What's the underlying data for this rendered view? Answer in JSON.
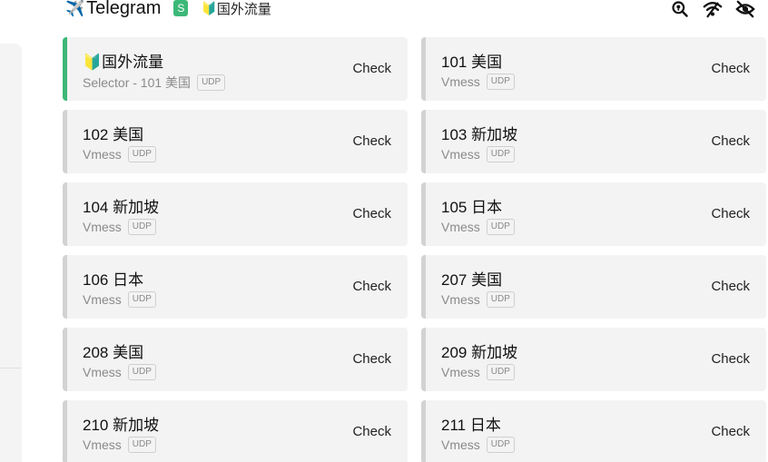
{
  "header": {
    "group_icon": "✈️",
    "group_name": "Telegram",
    "type_badge": "S",
    "now_icon": "🔰",
    "now_name": "国外流量"
  },
  "actions": [
    {
      "icon": "location-search-icon"
    },
    {
      "icon": "wifi-check-icon"
    },
    {
      "icon": "eye-off-icon"
    }
  ],
  "colors": {
    "accent": "#3cb878",
    "card_bg": "#f3f3f3",
    "inactive_bar": "#d2d2d2"
  },
  "proxies": [
    {
      "name": "🔰国外流量",
      "type": "Selector - 101 美国",
      "udp": "UDP",
      "action": "Check",
      "selected": true
    },
    {
      "name": "101 美国",
      "type": "Vmess",
      "udp": "UDP",
      "action": "Check",
      "selected": false
    },
    {
      "name": "102 美国",
      "type": "Vmess",
      "udp": "UDP",
      "action": "Check",
      "selected": false
    },
    {
      "name": "103 新加坡",
      "type": "Vmess",
      "udp": "UDP",
      "action": "Check",
      "selected": false
    },
    {
      "name": "104 新加坡",
      "type": "Vmess",
      "udp": "UDP",
      "action": "Check",
      "selected": false
    },
    {
      "name": "105 日本",
      "type": "Vmess",
      "udp": "UDP",
      "action": "Check",
      "selected": false
    },
    {
      "name": "106 日本",
      "type": "Vmess",
      "udp": "UDP",
      "action": "Check",
      "selected": false
    },
    {
      "name": "207 美国",
      "type": "Vmess",
      "udp": "UDP",
      "action": "Check",
      "selected": false
    },
    {
      "name": "208 美国",
      "type": "Vmess",
      "udp": "UDP",
      "action": "Check",
      "selected": false
    },
    {
      "name": "209 新加坡",
      "type": "Vmess",
      "udp": "UDP",
      "action": "Check",
      "selected": false
    },
    {
      "name": "210 新加坡",
      "type": "Vmess",
      "udp": "UDP",
      "action": "Check",
      "selected": false
    },
    {
      "name": "211 日本",
      "type": "Vmess",
      "udp": "UDP",
      "action": "Check",
      "selected": false
    }
  ]
}
